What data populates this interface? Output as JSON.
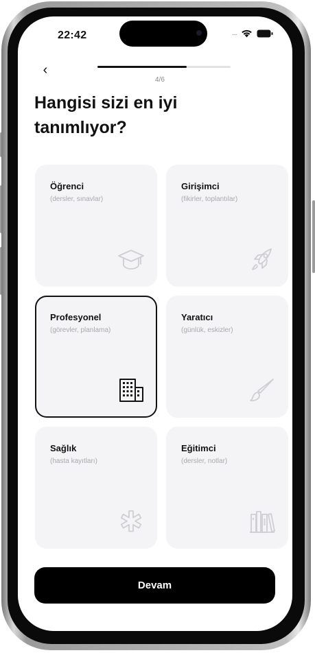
{
  "status_bar": {
    "time": "22:42",
    "signal": "....",
    "icons": [
      "wifi-icon",
      "battery-icon"
    ]
  },
  "nav": {
    "back_icon": "chevron-left-icon",
    "back_glyph": "‹",
    "step": "4/6",
    "progress": 0.67
  },
  "page": {
    "title": "Hangisi sizi en iyi tanımlıyor?"
  },
  "options": [
    {
      "title": "Öğrenci",
      "subtitle": "(dersler, sınavlar)",
      "icon": "graduation-cap-icon",
      "selected": false
    },
    {
      "title": "Girişimci",
      "subtitle": "(fikirler, toplantılar)",
      "icon": "rocket-icon",
      "selected": false
    },
    {
      "title": "Profesyonel",
      "subtitle": "(görevler, planlama)",
      "icon": "buildings-icon",
      "selected": true
    },
    {
      "title": "Yaratıcı",
      "subtitle": "(günlük, eskizler)",
      "icon": "paintbrush-icon",
      "selected": false
    },
    {
      "title": "Sağlık",
      "subtitle": "(hasta kayıtları)",
      "icon": "medical-star-icon",
      "selected": false
    },
    {
      "title": "Eğitimci",
      "subtitle": "(dersler, notlar)",
      "icon": "books-icon",
      "selected": false
    }
  ],
  "footer": {
    "continue_label": "Devam"
  },
  "colors": {
    "card_bg": "#f4f3f6",
    "accent": "#000000",
    "icon_muted": "#cfcfd3",
    "icon_selected": "#111111"
  }
}
